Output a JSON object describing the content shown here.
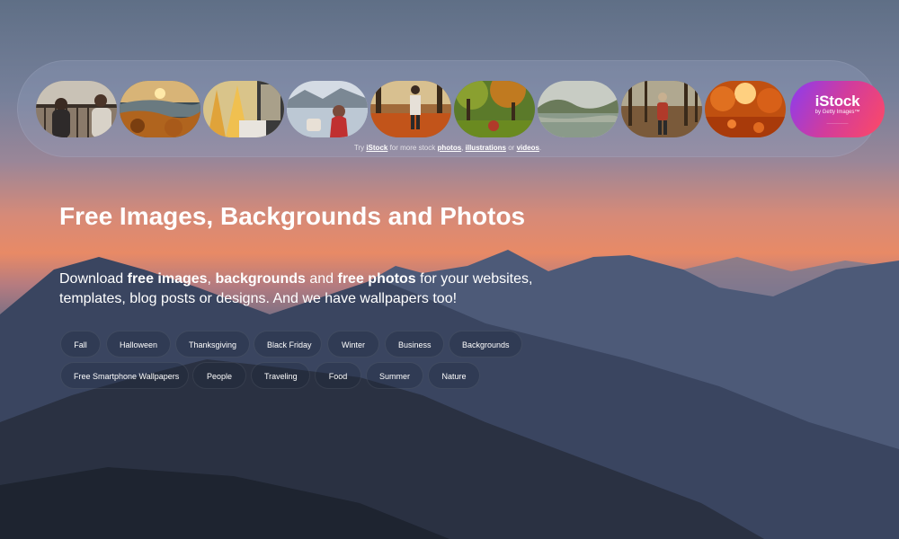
{
  "banner": {
    "thumbnails": [
      {
        "icon": "couple-balcony-photo"
      },
      {
        "icon": "autumn-sunset-landscape-photo"
      },
      {
        "icon": "autumn-trees-window-photo"
      },
      {
        "icon": "girl-lake-photo"
      },
      {
        "icon": "autumn-leaves-walk-photo"
      },
      {
        "icon": "autumn-forest-photo"
      },
      {
        "icon": "misty-lake-photo"
      },
      {
        "icon": "hiker-forest-photo"
      },
      {
        "icon": "autumn-leaves-sunlight-photo"
      }
    ],
    "istock": {
      "logo": "iStock",
      "sub": "by Getty Images™",
      "mini": "——————"
    },
    "caption": {
      "t1": "Try",
      "brand": "iStock",
      "t2": "for more stock",
      "photos": "photos",
      "sep": ",",
      "illustrations": "illustrations",
      "or": "or",
      "videos": "videos",
      "end": "."
    }
  },
  "hero": {
    "title": "Free Images, Backgrounds and Photos",
    "desc": {
      "a": "Download ",
      "b": "free images",
      "c": ", ",
      "d": "backgrounds",
      "e": " and ",
      "f": "free photos",
      "g": " for your websites, templates, blog posts or designs. And we have wallpapers too!"
    }
  },
  "tags": [
    "Fall",
    "Halloween",
    "Thanksgiving",
    "Black Friday",
    "Winter",
    "Business",
    "Backgrounds",
    "Free Smartphone Wallpapers",
    "People",
    "Traveling",
    "Food",
    "Summer",
    "Nature"
  ],
  "colors": {
    "sky_top": "#5f6f86",
    "sky_glow": "#e88a66",
    "mountain_dark": "#242b38",
    "istock_gradient_start": "#8a3cf0",
    "istock_gradient_end": "#ff4a63"
  }
}
